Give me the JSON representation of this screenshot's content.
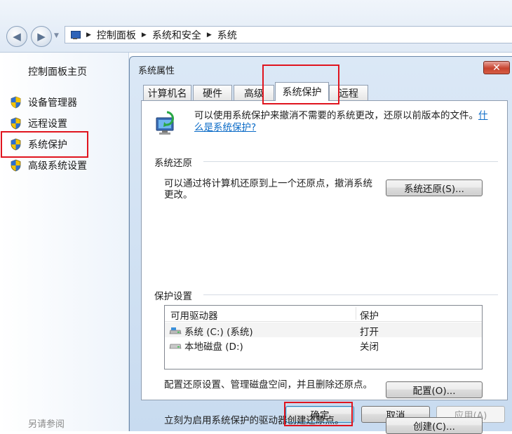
{
  "breadcrumb": {
    "items": [
      "控制面板",
      "系统和安全",
      "系统"
    ]
  },
  "sidebar": {
    "home": "控制面板主页",
    "tasks": [
      {
        "label": "设备管理器"
      },
      {
        "label": "远程设置"
      },
      {
        "label": "系统保护"
      },
      {
        "label": "高级系统设置"
      }
    ],
    "see_also": "另请参阅"
  },
  "dialog": {
    "title": "系统属性",
    "close_glyph": "✕",
    "tabs": [
      "计算机名",
      "硬件",
      "高级",
      "系统保护",
      "远程"
    ],
    "description": "可以使用系统保护来撤消不需要的系统更改，还原以前版本的文件。",
    "what_is_link": "什么是系统保护?",
    "restore_group": {
      "heading": "系统还原",
      "text": "可以通过将计算机还原到上一个还原点，撤消系统更改。",
      "button": "系统还原(S)..."
    },
    "protection_group": {
      "heading": "保护设置",
      "columns": [
        "可用驱动器",
        "保护"
      ],
      "rows": [
        {
          "drive": "系统 (C:) (系统)",
          "protection": "打开"
        },
        {
          "drive": "本地磁盘 (D:)",
          "protection": "关闭"
        }
      ],
      "configure_text": "配置还原设置、管理磁盘空间，并且删除还原点。",
      "configure_button": "配置(O)...",
      "create_text": "立刻为启用系统保护的驱动器创建还原点。",
      "create_button": "创建(C)..."
    },
    "footer": {
      "ok": "确定",
      "cancel": "取消",
      "apply": "应用(A)"
    }
  },
  "colors": {
    "highlight_box": "#e0141e",
    "link": "#0b6bc7"
  }
}
